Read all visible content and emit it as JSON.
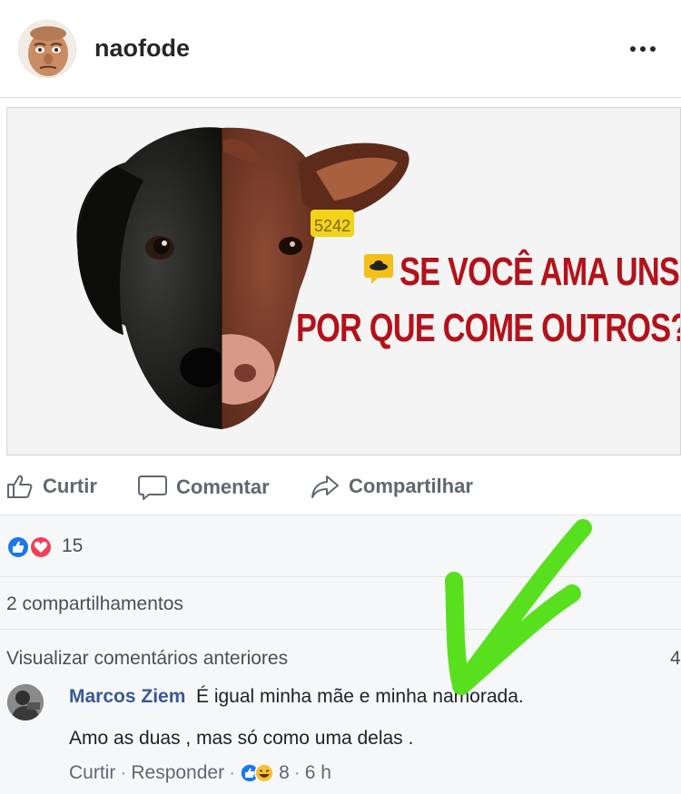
{
  "header": {
    "username": "naofode",
    "avatar_icon": "caricature-avatar-icon",
    "more_icon": "more-options-icon"
  },
  "post": {
    "image_text_line1": "SE VOCÊ AMA UNS,",
    "image_text_line2": "POR QUE COME OUTROS?",
    "ear_tag": "5242",
    "slogan_color": "#b3121b"
  },
  "actions": {
    "like": "Curtir",
    "comment": "Comentar",
    "share": "Compartilhar"
  },
  "reactions": {
    "count": "15",
    "icons": [
      "like-icon",
      "love-icon"
    ]
  },
  "shares": {
    "label": "2 compartilhamentos"
  },
  "comments": {
    "view_previous": "Visualizar comentários anteriores",
    "previous_count": "4",
    "items": [
      {
        "author": "Marcos Ziem",
        "text_line1": "É igual minha mãe e minha namorada.",
        "text_line2": "Amo as duas , mas só como uma delas .",
        "like": "Curtir",
        "reply": "Responder",
        "reaction_count": "8",
        "time": "6 h"
      }
    ]
  },
  "colors": {
    "link_blue": "#385898",
    "annotation_green": "#58e01f"
  }
}
